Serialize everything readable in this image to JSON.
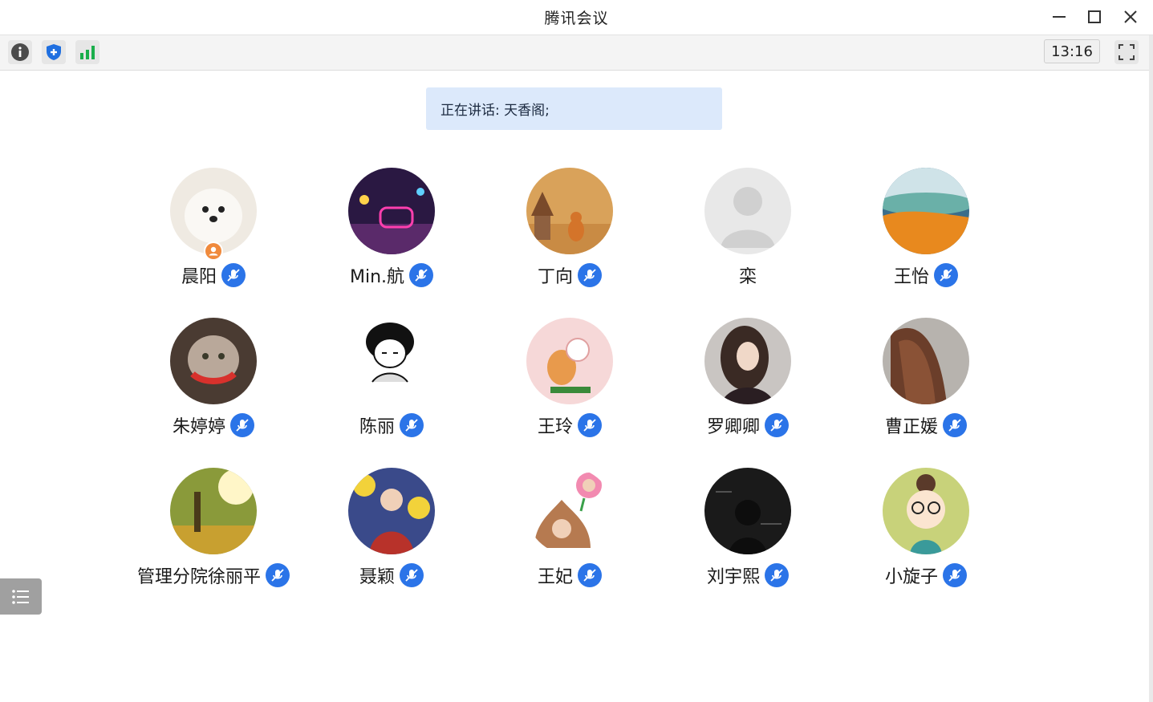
{
  "window": {
    "title": "腾讯会议",
    "controls": [
      "minimize-icon",
      "maximize-icon",
      "close-icon"
    ]
  },
  "toolbar": {
    "icons": [
      "info-icon",
      "security-shield-icon",
      "network-signal-icon"
    ],
    "clock": "13:16",
    "fullscreen_icon": "fullscreen-icon"
  },
  "speaking": {
    "text": "正在讲话: 天香阁;"
  },
  "participants": [
    {
      "name": "晨阳",
      "muted": true,
      "host": true
    },
    {
      "name": "Min.航",
      "muted": true
    },
    {
      "name": "丁向",
      "muted": true
    },
    {
      "name": "栾",
      "muted": false
    },
    {
      "name": "王怡",
      "muted": true
    },
    {
      "name": "朱婷婷",
      "muted": true
    },
    {
      "name": "陈丽",
      "muted": true
    },
    {
      "name": "王玲",
      "muted": true
    },
    {
      "name": "罗卿卿",
      "muted": true
    },
    {
      "name": "曹正媛",
      "muted": true
    },
    {
      "name": "管理分院徐丽平",
      "muted": true
    },
    {
      "name": "聂颖",
      "muted": true
    },
    {
      "name": "王妃",
      "muted": true
    },
    {
      "name": "刘宇熙",
      "muted": true
    },
    {
      "name": "小旋子",
      "muted": true
    }
  ],
  "sidebar": {
    "list_icon": "member-list-icon"
  },
  "colors": {
    "accent": "#2b74e8",
    "speaking_bg": "#dce9fb",
    "host_badge": "#f08a3c"
  }
}
